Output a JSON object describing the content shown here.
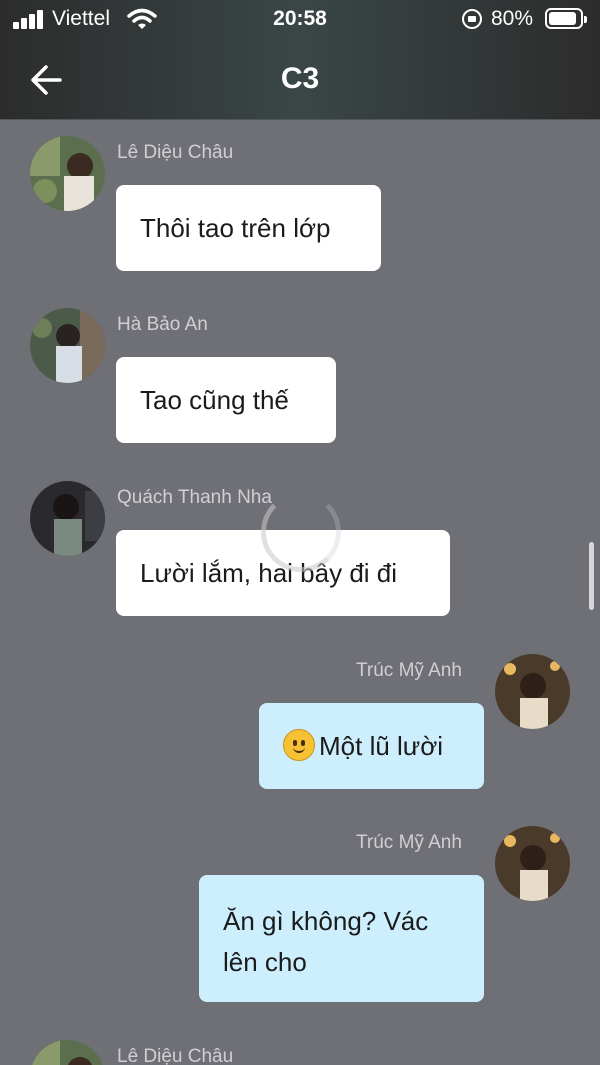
{
  "status_bar": {
    "carrier": "Viettel",
    "time": "20:58",
    "battery_percent": "80%",
    "battery_level": 0.8,
    "signal_bars": 4
  },
  "header": {
    "title": "C3",
    "back_icon": "arrow-left-icon"
  },
  "messages": [
    {
      "sender": "Lê Diệu Châu",
      "text": "Thôi tao trên lớp",
      "direction": "incoming"
    },
    {
      "sender": "Hà Bảo An",
      "text": "Tao cũng thế",
      "direction": "incoming"
    },
    {
      "sender": "Quách Thanh Nha",
      "text": "Lười lắm, hai bây đi đi",
      "direction": "incoming"
    },
    {
      "sender": "Trúc Mỹ Anh",
      "text": "Một lũ lười",
      "emoji": "slightly-smiling-face-icon",
      "direction": "outgoing"
    },
    {
      "sender": "Trúc Mỹ Anh",
      "text_lines": [
        "Ăn gì không? Vác",
        "lên cho"
      ],
      "direction": "outgoing"
    },
    {
      "sender": "Lê Diệu Châu",
      "direction": "incoming"
    }
  ],
  "colors": {
    "background": "#6f6f76",
    "incoming_bubble": "#ffffff",
    "outgoing_bubble": "#cdeffd",
    "sender_name": "#cfcfd4"
  }
}
